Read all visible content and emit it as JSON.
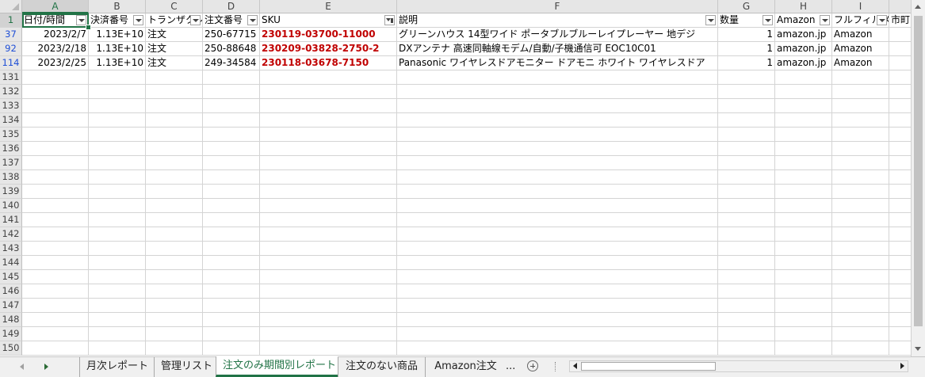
{
  "columns": [
    {
      "letter": "A",
      "width": 84
    },
    {
      "letter": "B",
      "width": 72
    },
    {
      "letter": "C",
      "width": 72
    },
    {
      "letter": "D",
      "width": 72
    },
    {
      "letter": "E",
      "width": 173
    },
    {
      "letter": "F",
      "width": 405
    },
    {
      "letter": "G",
      "width": 72
    },
    {
      "letter": "H",
      "width": 72
    },
    {
      "letter": "I",
      "width": 72
    },
    {
      "letter": "",
      "width": 49
    }
  ],
  "header_row": {
    "number": "1",
    "cells": [
      "日付/時間",
      "決済番号",
      "トランザクション",
      "注文番号",
      "SKU",
      "説明",
      "数量",
      "Amazon",
      "フルフィルメント",
      "市町"
    ],
    "filter_active_column": 4
  },
  "data_rows": [
    {
      "number": "37",
      "cells": [
        "2023/2/7",
        "1.13E+10",
        "注文",
        "250-67715",
        "230119-03700-11000",
        "グリーンハウス 14型ワイド ポータブルブルーレイプレーヤー 地デジ",
        "1",
        "amazon.jp",
        "Amazon",
        ""
      ]
    },
    {
      "number": "92",
      "cells": [
        "2023/2/18",
        "1.13E+10",
        "注文",
        "250-88648",
        "230209-03828-2750-2",
        "DXアンテナ 高速同軸線モデム/自動/子機通信可 EOC10C01",
        "1",
        "amazon.jp",
        "Amazon",
        ""
      ]
    },
    {
      "number": "114",
      "cells": [
        "2023/2/25",
        "1.13E+10",
        "注文",
        "249-34584",
        "230118-03678-7150",
        "Panasonic ワイヤレスドアモニター ドアモニ ホワイト ワイヤレスドア",
        "1",
        "amazon.jp",
        "Amazon",
        ""
      ]
    }
  ],
  "right_aligned_columns": [
    0,
    1,
    6
  ],
  "sku_column": 4,
  "empty_rows": [
    "131",
    "132",
    "133",
    "134",
    "135",
    "136",
    "137",
    "138",
    "139",
    "140",
    "141",
    "142",
    "143",
    "144",
    "145",
    "146",
    "147",
    "148",
    "149",
    "150"
  ],
  "active_cell": {
    "column": "A",
    "row": "1"
  },
  "sheet_tabs": [
    {
      "label": "月次レポート",
      "active": false
    },
    {
      "label": "管理リスト",
      "active": false
    },
    {
      "label": "注文のみ期間別レポート",
      "active": true
    },
    {
      "label": "注文のない商品",
      "active": false
    },
    {
      "label": "Amazon注文",
      "active": false
    }
  ],
  "tab_overflow": "...",
  "colors": {
    "accent_green": "#217346",
    "sku_red": "#c00000",
    "filtered_row_blue": "#1f4fd6"
  },
  "icons": {
    "sheet_prev": "triangle-left-icon",
    "sheet_next": "triangle-right-icon",
    "add_sheet": "plus-circle-icon",
    "filter_dropdown": "dropdown-arrow-icon",
    "filter_applied": "filter-funnel-icon"
  }
}
